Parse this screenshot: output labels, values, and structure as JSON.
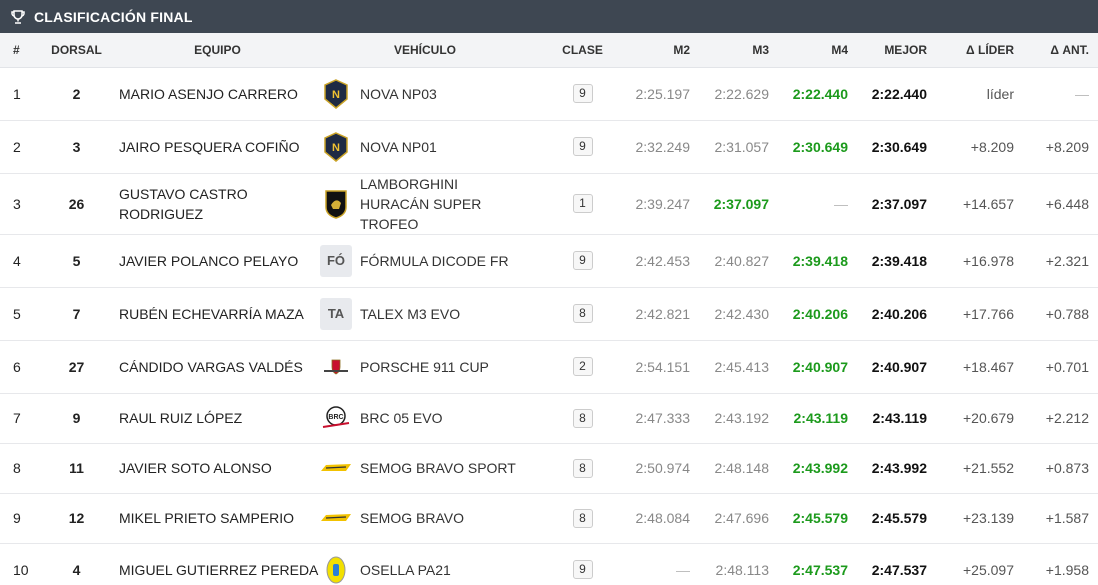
{
  "title": "CLASIFICACIÓN FINAL",
  "headers": {
    "pos": "#",
    "dorsal": "DORSAL",
    "team": "EQUIPO",
    "vehicle": "VEHÍCULO",
    "class": "CLASE",
    "m2": "M2",
    "m3": "M3",
    "m4": "M4",
    "best": "MEJOR",
    "delta_leader": "Δ LÍDER",
    "delta_prev": "Δ ANT."
  },
  "rows": [
    {
      "pos": "1",
      "dorsal": "2",
      "team": "MARIO ASENJO CARRERO",
      "vehicle": "NOVA NP03",
      "logo": "nova",
      "class": "9",
      "m2": "2:25.197",
      "m3": "2:22.629",
      "m4": "2:22.440",
      "best": "2:22.440",
      "delta_leader": "líder",
      "delta_prev": "—",
      "best_lap": "m4"
    },
    {
      "pos": "2",
      "dorsal": "3",
      "team": "JAIRO PESQUERA COFIÑO",
      "vehicle": "NOVA NP01",
      "logo": "nova",
      "class": "9",
      "m2": "2:32.249",
      "m3": "2:31.057",
      "m4": "2:30.649",
      "best": "2:30.649",
      "delta_leader": "+8.209",
      "delta_prev": "+8.209",
      "best_lap": "m4"
    },
    {
      "pos": "3",
      "dorsal": "26",
      "team": "GUSTAVO CASTRO RODRIGUEZ",
      "vehicle": "LAMBORGHINI HURACÁN SUPER TROFEO",
      "logo": "lamborghini",
      "class": "1",
      "m2": "2:39.247",
      "m3": "2:37.097",
      "m4": "—",
      "best": "2:37.097",
      "delta_leader": "+14.657",
      "delta_prev": "+6.448",
      "best_lap": "m3"
    },
    {
      "pos": "4",
      "dorsal": "5",
      "team": "JAVIER POLANCO PELAYO",
      "vehicle": "FÓRMULA DICODE FR",
      "logo": "text",
      "logo_text": "FÓ",
      "class": "9",
      "m2": "2:42.453",
      "m3": "2:40.827",
      "m4": "2:39.418",
      "best": "2:39.418",
      "delta_leader": "+16.978",
      "delta_prev": "+2.321",
      "best_lap": "m4"
    },
    {
      "pos": "5",
      "dorsal": "7",
      "team": "RUBÉN ECHEVARRÍA MAZA",
      "vehicle": "TALEX M3 EVO",
      "logo": "text",
      "logo_text": "TA",
      "class": "8",
      "m2": "2:42.821",
      "m3": "2:42.430",
      "m4": "2:40.206",
      "best": "2:40.206",
      "delta_leader": "+17.766",
      "delta_prev": "+0.788",
      "best_lap": "m4"
    },
    {
      "pos": "6",
      "dorsal": "27",
      "team": "CÁNDIDO VARGAS VALDÉS",
      "vehicle": "PORSCHE 911 CUP",
      "logo": "porsche",
      "class": "2",
      "m2": "2:54.151",
      "m3": "2:45.413",
      "m4": "2:40.907",
      "best": "2:40.907",
      "delta_leader": "+18.467",
      "delta_prev": "+0.701",
      "best_lap": "m4"
    },
    {
      "pos": "7",
      "dorsal": "9",
      "team": "RAUL RUIZ LÓPEZ",
      "vehicle": "BRC 05 EVO",
      "logo": "brc",
      "class": "8",
      "m2": "2:47.333",
      "m3": "2:43.192",
      "m4": "2:43.119",
      "best": "2:43.119",
      "delta_leader": "+20.679",
      "delta_prev": "+2.212",
      "best_lap": "m4"
    },
    {
      "pos": "8",
      "dorsal": "11",
      "team": "JAVIER SOTO ALONSO",
      "vehicle": "SEMOG BRAVO SPORT",
      "logo": "semog",
      "class": "8",
      "m2": "2:50.974",
      "m3": "2:48.148",
      "m4": "2:43.992",
      "best": "2:43.992",
      "delta_leader": "+21.552",
      "delta_prev": "+0.873",
      "best_lap": "m4"
    },
    {
      "pos": "9",
      "dorsal": "12",
      "team": "MIKEL PRIETO SAMPERIO",
      "vehicle": "SEMOG BRAVO",
      "logo": "semog",
      "class": "8",
      "m2": "2:48.084",
      "m3": "2:47.696",
      "m4": "2:45.579",
      "best": "2:45.579",
      "delta_leader": "+23.139",
      "delta_prev": "+1.587",
      "best_lap": "m4"
    },
    {
      "pos": "10",
      "dorsal": "4",
      "team": "MIGUEL GUTIERREZ PEREDA",
      "vehicle": "OSELLA PA21",
      "logo": "osella",
      "class": "9",
      "m2": "—",
      "m3": "2:48.113",
      "m4": "2:47.537",
      "best": "2:47.537",
      "delta_leader": "+25.097",
      "delta_prev": "+1.958",
      "best_lap": "m4"
    }
  ],
  "colors": {
    "header_bg": "#3e4752",
    "best_lap": "#1c9a1c"
  }
}
